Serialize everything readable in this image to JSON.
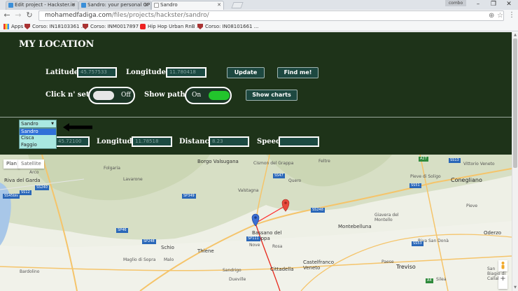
{
  "browser": {
    "tabs": [
      {
        "title": "Edit project - Hackster.io"
      },
      {
        "title": "Sandro: your personal GP"
      },
      {
        "title": "Sandro"
      }
    ],
    "user_label": "combo",
    "address": {
      "host": "mohamedfadiga.com",
      "path": "/files/projects/hackster/sandro/"
    },
    "bookmarks": [
      {
        "label": "Apps",
        "icon": "apps-grid-icon"
      },
      {
        "label": "Corso: IN18103361 ...",
        "icon": "shield-icon"
      },
      {
        "label": "Corso: INM0017897 ...",
        "icon": "shield-icon"
      },
      {
        "label": "Hip Hop Urban RnB ...",
        "icon": "youtube-icon"
      },
      {
        "label": "Corso: IN08101661 ...",
        "icon": "shield-icon"
      }
    ]
  },
  "app": {
    "title": "MY LOCATION",
    "latitude_label": "Latitude",
    "latitude_value": "45.757533",
    "longitude_label": "Longitude",
    "longitude_value": "11.780418",
    "update_button": "Update",
    "findme_button": "Find me!",
    "clickset_label": "Click n' set",
    "clickset_state": "Off",
    "showpath_label": "Show path",
    "showpath_state": "On",
    "showcharts_button": "Show charts",
    "colors": {
      "background": "#1e3319",
      "field": "#1c4a42",
      "toggle_on": "#22c42c",
      "dropdown": "#a9e8e1"
    }
  },
  "stats": {
    "device_selected": "Sandro",
    "device_options": [
      "Sandro",
      "Cisca",
      "Faggio"
    ],
    "latitude_value": "45.72100",
    "longitude_label": "Longitude",
    "longitude_value": "11.78518",
    "distance_label": "Distance",
    "distance_value": "8.23",
    "speed_label": "Speed",
    "speed_value": ""
  },
  "map": {
    "type_plan": "Plan",
    "type_satellite": "Satellite",
    "labels": [
      {
        "text": "Riva del Garda"
      },
      {
        "text": "Arco"
      },
      {
        "text": "Folgaria"
      },
      {
        "text": "Lavarone"
      },
      {
        "text": "Borgo Valsugana"
      },
      {
        "text": "Feltre"
      },
      {
        "text": "Cismon del Grappa"
      },
      {
        "text": "Valstagna"
      },
      {
        "text": "Quero"
      },
      {
        "text": "Pieve di Soligo"
      },
      {
        "text": "Conegliano"
      },
      {
        "text": "Vittorio Veneto"
      },
      {
        "text": "Bassano del Grappa"
      },
      {
        "text": "Montebelluna"
      },
      {
        "text": "Giavera del Montello"
      },
      {
        "text": "Oderzo"
      },
      {
        "text": "Nove"
      },
      {
        "text": "Rosa"
      },
      {
        "text": "Schio"
      },
      {
        "text": "Thiene"
      },
      {
        "text": "Malo"
      },
      {
        "text": "Maglio di Sopra"
      },
      {
        "text": "Cittadella"
      },
      {
        "text": "Castelfranco Veneto"
      },
      {
        "text": "Treviso"
      },
      {
        "text": "Paese"
      },
      {
        "text": "Sandrigo"
      },
      {
        "text": "Dueville"
      },
      {
        "text": "Bardolino"
      },
      {
        "text": "Riva San Donà"
      },
      {
        "text": "San Biagio di Callalta"
      },
      {
        "text": "Silea"
      },
      {
        "text": "Pieve"
      }
    ],
    "roads": [
      "SS12",
      "SS240",
      "SS45bis",
      "SP349",
      "SS47",
      "SP111",
      "A4",
      "A27",
      "SS13",
      "SS53",
      "SS51",
      "SP46",
      "SS248",
      "SP248"
    ]
  }
}
